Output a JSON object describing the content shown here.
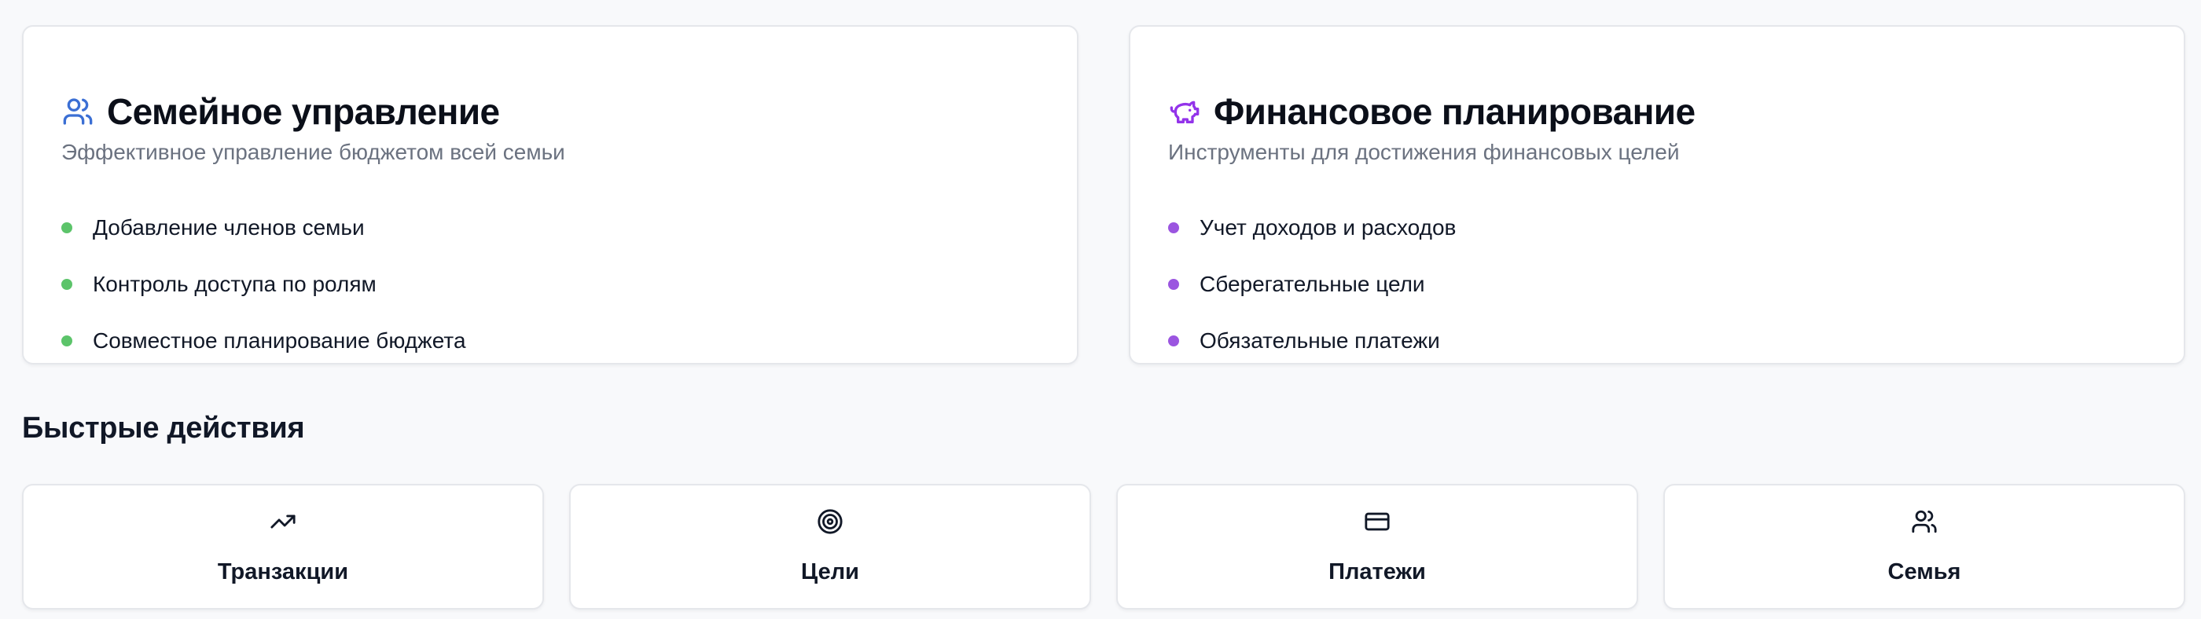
{
  "colors": {
    "family_accent": "#3b6fd4",
    "finance_accent": "#9333ea",
    "family_bullet": "#5cc46a",
    "finance_bullet": "#9b55e0"
  },
  "family_card": {
    "icon": "users-icon",
    "title": "Семейное управление",
    "subtitle": "Эффективное управление бюджетом всей семьи",
    "items": [
      "Добавление членов семьи",
      "Контроль доступа по ролям",
      "Совместное планирование бюджета"
    ]
  },
  "finance_card": {
    "icon": "piggy-bank-icon",
    "title": "Финансовое планирование",
    "subtitle": "Инструменты для достижения финансовых целей",
    "items": [
      "Учет доходов и расходов",
      "Сберегательные цели",
      "Обязательные платежи"
    ]
  },
  "quick_actions": {
    "title": "Быстрые действия",
    "items": [
      {
        "label": "Транзакции",
        "icon": "trending-up-icon"
      },
      {
        "label": "Цели",
        "icon": "target-icon"
      },
      {
        "label": "Платежи",
        "icon": "credit-card-icon"
      },
      {
        "label": "Семья",
        "icon": "users-icon"
      }
    ]
  }
}
